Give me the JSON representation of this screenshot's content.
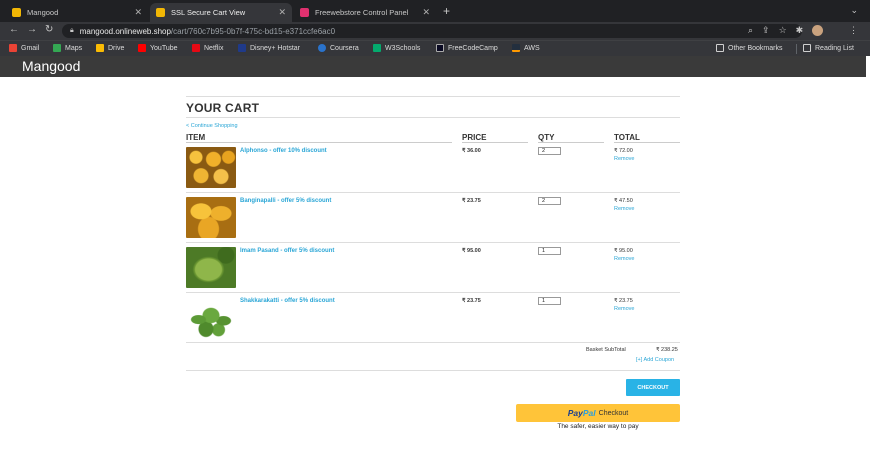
{
  "browser": {
    "tabs": [
      {
        "title": "Mangood",
        "active": false
      },
      {
        "title": "SSL Secure Cart View",
        "active": true
      },
      {
        "title": "Freewebstore Control Panel",
        "active": false
      }
    ],
    "url_host": "mangood.onlineweb.shop",
    "url_path": "/cart/760c7b95-0b7f-475c-bd15-e371ccfe6ac0",
    "bookmarks": [
      "Gmail",
      "Maps",
      "Drive",
      "YouTube",
      "Netflix",
      "Disney+ Hotstar",
      "Coursera",
      "W3Schools",
      "FreeCodeCamp",
      "AWS"
    ],
    "other_bookmarks": "Other Bookmarks",
    "reading_list": "Reading List"
  },
  "site": {
    "brand": "Mangood"
  },
  "cart": {
    "title": "YOUR CART",
    "continue": "< Continue Shopping",
    "columns": {
      "item": "ITEM",
      "price": "PRICE",
      "qty": "QTY",
      "total": "TOTAL"
    },
    "items": [
      {
        "name": "Alphonso - offer 10% discount",
        "price": "₹ 36.00",
        "qty": "2",
        "total": "₹ 72.00",
        "remove": "Remove"
      },
      {
        "name": "Banginapalli - offer 5% discount",
        "price": "₹ 23.75",
        "qty": "2",
        "total": "₹ 47.50",
        "remove": "Remove"
      },
      {
        "name": "Imam Pasand - offer 5% discount",
        "price": "₹ 95.00",
        "qty": "1",
        "total": "₹ 95.00",
        "remove": "Remove"
      },
      {
        "name": "Shakkarakatti - offer 5% discount",
        "price": "₹ 23.75",
        "qty": "1",
        "total": "₹ 23.75",
        "remove": "Remove"
      }
    ],
    "subtotal_label": "Basket SubTotal",
    "subtotal_value": "₹ 238.25",
    "coupon": "[+] Add Coupon",
    "checkout": "CHECKOUT",
    "paypal_word1": "Pay",
    "paypal_word2": "Pal",
    "paypal_label": "Checkout",
    "paypal_tagline": "The safer, easier way to pay"
  },
  "colors": {
    "link": "#2aa6d6",
    "checkout": "#29b3e6",
    "paypal": "#ffc439",
    "header": "#3a3a3a"
  }
}
